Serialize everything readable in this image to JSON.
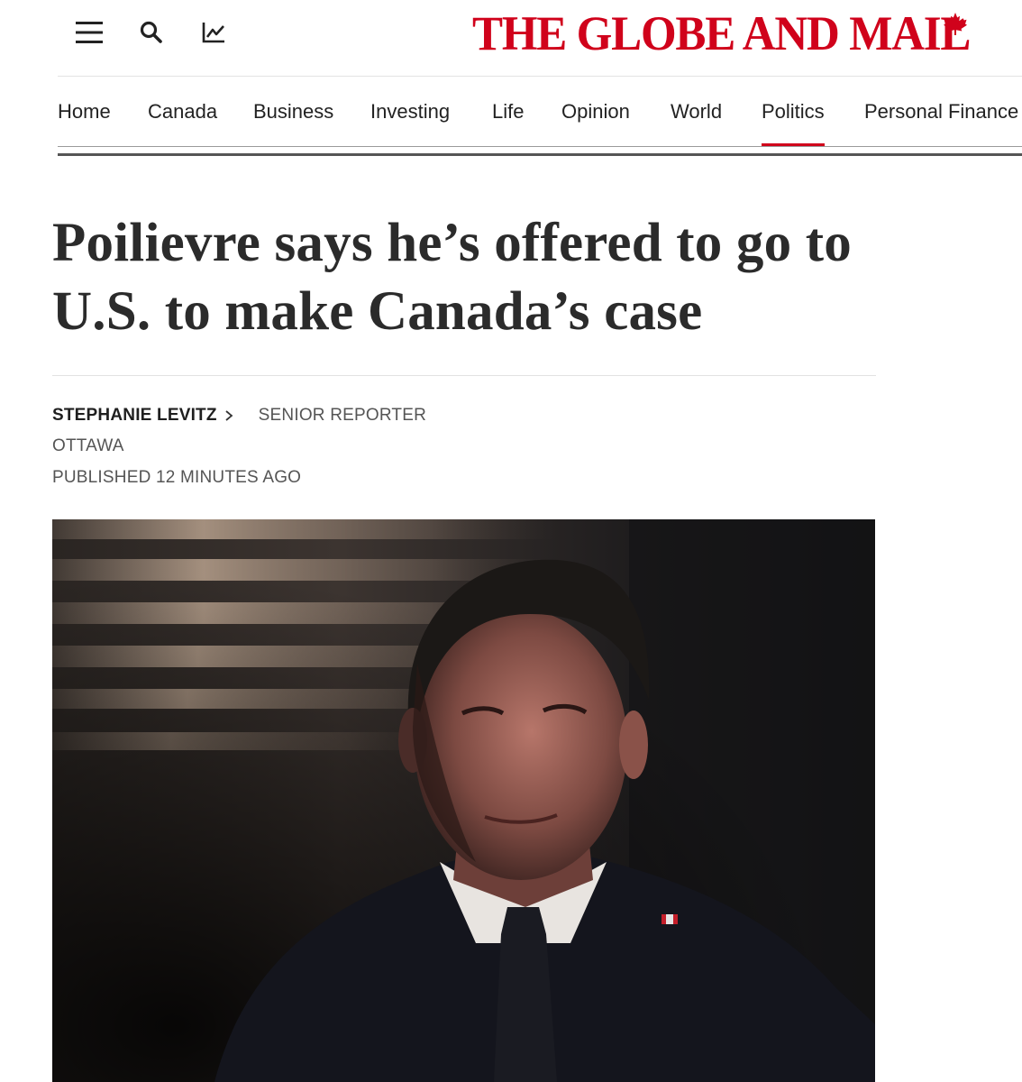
{
  "header": {
    "brand": "THE GLOBE AND MAIL",
    "brand_color": "#d0021b",
    "icons": [
      "menu-icon",
      "search-icon",
      "market-chart-icon",
      "maple-leaf-icon"
    ]
  },
  "nav": {
    "items": [
      {
        "label": "Home",
        "active": false
      },
      {
        "label": "Canada",
        "active": false
      },
      {
        "label": "Business",
        "active": false
      },
      {
        "label": "Investing",
        "active": false
      },
      {
        "label": "Life",
        "active": false
      },
      {
        "label": "Opinion",
        "active": false
      },
      {
        "label": "World",
        "active": false
      },
      {
        "label": "Politics",
        "active": true
      },
      {
        "label": "Personal Finance",
        "active": false
      }
    ],
    "active_color": "#d0021b"
  },
  "article": {
    "headline": "Poilievre says he’s offered to go to U.S. to make Canada’s case",
    "author": "STEPHANIE LEVITZ",
    "role": "SENIOR REPORTER",
    "dateline": "OTTAWA",
    "published": "PUBLISHED 12 MINUTES AGO"
  }
}
